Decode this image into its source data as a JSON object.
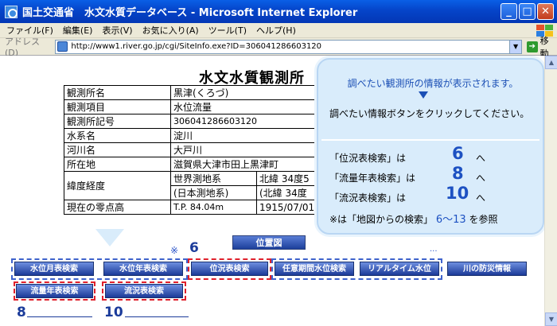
{
  "window": {
    "title": "国土交通省　水文水質データベース - Microsoft Internet Explorer",
    "minimize": "_",
    "maximize": "□",
    "close": "✕"
  },
  "menu": [
    "ファイル(F)",
    "編集(E)",
    "表示(V)",
    "お気に入り(A)",
    "ツール(T)",
    "ヘルプ(H)"
  ],
  "address": {
    "label": "アドレス(D)",
    "url": "http://www1.river.go.jp/cgi/SiteInfo.exe?ID=306041286603120",
    "go": "移動"
  },
  "page": {
    "title": "水文水質観測所",
    "rows": [
      {
        "label": "観測所名",
        "value": "黒津(くろづ)"
      },
      {
        "label": "観測項目",
        "value": "水位流量"
      },
      {
        "label": "観測所記号",
        "value": "306041286603120"
      },
      {
        "label": "水系名",
        "value": "淀川"
      },
      {
        "label": "河川名",
        "value": "大戸川"
      },
      {
        "label": "所在地",
        "value": "滋賀県大津市田上黒津町"
      }
    ],
    "latlon": {
      "label": "緯度経度",
      "a1": "世界測地系",
      "a2": "北緯 34度5",
      "b1": "(日本測地系)",
      "b2": "(北緯 34度"
    },
    "zero": {
      "label": "現在の零点高",
      "v1": "T.P. 84.04m",
      "v2": "1915/07/01"
    }
  },
  "buttons": {
    "map": "位置図",
    "monthly_stage": "水位月表検索",
    "annual_stage": "水位年表検索",
    "stage_status": "位況表検索",
    "arbitrary_stage": "任意期間水位検索",
    "realtime_stage": "リアルタイム水位",
    "river_disaster": "川の防災情報",
    "annual_flow": "流量年表検索",
    "flow_status": "流況表検索"
  },
  "annotations": {
    "asterisk": "※",
    "num6": "6",
    "num8": "8",
    "num10": "10",
    "dots": "..."
  },
  "callout": {
    "header": "調べたい観測所の情報が表示されます。",
    "instruction": "調べたい情報ボタンをクリックしてください。",
    "items": [
      {
        "label": "「位況表検索」は",
        "num": "6",
        "suffix": "へ"
      },
      {
        "label": "「流量年表検索」は",
        "num": "8",
        "suffix": "へ"
      },
      {
        "label": "「流況表検索」は",
        "num": "10",
        "suffix": "へ"
      }
    ],
    "note_prefix": "※は「地図からの検索」",
    "note_range": "6〜13",
    "note_suffix": "を参照"
  }
}
